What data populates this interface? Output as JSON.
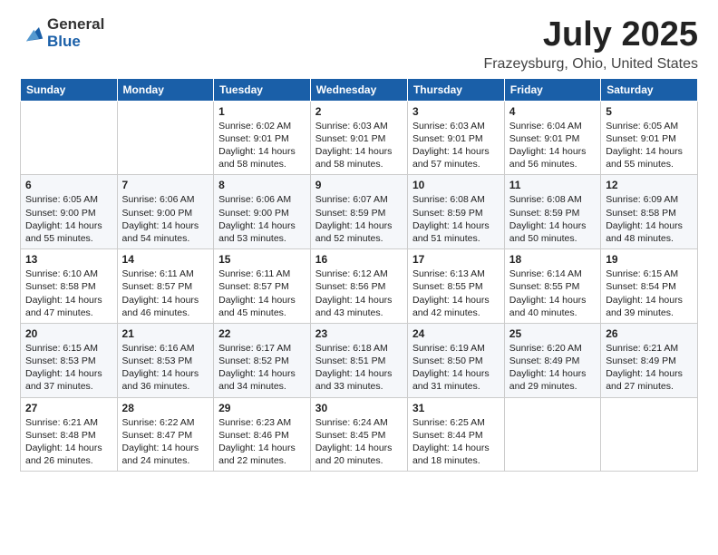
{
  "logo": {
    "general": "General",
    "blue": "Blue"
  },
  "title": "July 2025",
  "subtitle": "Frazeysburg, Ohio, United States",
  "days_of_week": [
    "Sunday",
    "Monday",
    "Tuesday",
    "Wednesday",
    "Thursday",
    "Friday",
    "Saturday"
  ],
  "weeks": [
    [
      {
        "day": "",
        "content": ""
      },
      {
        "day": "",
        "content": ""
      },
      {
        "day": "1",
        "content": "Sunrise: 6:02 AM\nSunset: 9:01 PM\nDaylight: 14 hours and 58 minutes."
      },
      {
        "day": "2",
        "content": "Sunrise: 6:03 AM\nSunset: 9:01 PM\nDaylight: 14 hours and 58 minutes."
      },
      {
        "day": "3",
        "content": "Sunrise: 6:03 AM\nSunset: 9:01 PM\nDaylight: 14 hours and 57 minutes."
      },
      {
        "day": "4",
        "content": "Sunrise: 6:04 AM\nSunset: 9:01 PM\nDaylight: 14 hours and 56 minutes."
      },
      {
        "day": "5",
        "content": "Sunrise: 6:05 AM\nSunset: 9:01 PM\nDaylight: 14 hours and 55 minutes."
      }
    ],
    [
      {
        "day": "6",
        "content": "Sunrise: 6:05 AM\nSunset: 9:00 PM\nDaylight: 14 hours and 55 minutes."
      },
      {
        "day": "7",
        "content": "Sunrise: 6:06 AM\nSunset: 9:00 PM\nDaylight: 14 hours and 54 minutes."
      },
      {
        "day": "8",
        "content": "Sunrise: 6:06 AM\nSunset: 9:00 PM\nDaylight: 14 hours and 53 minutes."
      },
      {
        "day": "9",
        "content": "Sunrise: 6:07 AM\nSunset: 8:59 PM\nDaylight: 14 hours and 52 minutes."
      },
      {
        "day": "10",
        "content": "Sunrise: 6:08 AM\nSunset: 8:59 PM\nDaylight: 14 hours and 51 minutes."
      },
      {
        "day": "11",
        "content": "Sunrise: 6:08 AM\nSunset: 8:59 PM\nDaylight: 14 hours and 50 minutes."
      },
      {
        "day": "12",
        "content": "Sunrise: 6:09 AM\nSunset: 8:58 PM\nDaylight: 14 hours and 48 minutes."
      }
    ],
    [
      {
        "day": "13",
        "content": "Sunrise: 6:10 AM\nSunset: 8:58 PM\nDaylight: 14 hours and 47 minutes."
      },
      {
        "day": "14",
        "content": "Sunrise: 6:11 AM\nSunset: 8:57 PM\nDaylight: 14 hours and 46 minutes."
      },
      {
        "day": "15",
        "content": "Sunrise: 6:11 AM\nSunset: 8:57 PM\nDaylight: 14 hours and 45 minutes."
      },
      {
        "day": "16",
        "content": "Sunrise: 6:12 AM\nSunset: 8:56 PM\nDaylight: 14 hours and 43 minutes."
      },
      {
        "day": "17",
        "content": "Sunrise: 6:13 AM\nSunset: 8:55 PM\nDaylight: 14 hours and 42 minutes."
      },
      {
        "day": "18",
        "content": "Sunrise: 6:14 AM\nSunset: 8:55 PM\nDaylight: 14 hours and 40 minutes."
      },
      {
        "day": "19",
        "content": "Sunrise: 6:15 AM\nSunset: 8:54 PM\nDaylight: 14 hours and 39 minutes."
      }
    ],
    [
      {
        "day": "20",
        "content": "Sunrise: 6:15 AM\nSunset: 8:53 PM\nDaylight: 14 hours and 37 minutes."
      },
      {
        "day": "21",
        "content": "Sunrise: 6:16 AM\nSunset: 8:53 PM\nDaylight: 14 hours and 36 minutes."
      },
      {
        "day": "22",
        "content": "Sunrise: 6:17 AM\nSunset: 8:52 PM\nDaylight: 14 hours and 34 minutes."
      },
      {
        "day": "23",
        "content": "Sunrise: 6:18 AM\nSunset: 8:51 PM\nDaylight: 14 hours and 33 minutes."
      },
      {
        "day": "24",
        "content": "Sunrise: 6:19 AM\nSunset: 8:50 PM\nDaylight: 14 hours and 31 minutes."
      },
      {
        "day": "25",
        "content": "Sunrise: 6:20 AM\nSunset: 8:49 PM\nDaylight: 14 hours and 29 minutes."
      },
      {
        "day": "26",
        "content": "Sunrise: 6:21 AM\nSunset: 8:49 PM\nDaylight: 14 hours and 27 minutes."
      }
    ],
    [
      {
        "day": "27",
        "content": "Sunrise: 6:21 AM\nSunset: 8:48 PM\nDaylight: 14 hours and 26 minutes."
      },
      {
        "day": "28",
        "content": "Sunrise: 6:22 AM\nSunset: 8:47 PM\nDaylight: 14 hours and 24 minutes."
      },
      {
        "day": "29",
        "content": "Sunrise: 6:23 AM\nSunset: 8:46 PM\nDaylight: 14 hours and 22 minutes."
      },
      {
        "day": "30",
        "content": "Sunrise: 6:24 AM\nSunset: 8:45 PM\nDaylight: 14 hours and 20 minutes."
      },
      {
        "day": "31",
        "content": "Sunrise: 6:25 AM\nSunset: 8:44 PM\nDaylight: 14 hours and 18 minutes."
      },
      {
        "day": "",
        "content": ""
      },
      {
        "day": "",
        "content": ""
      }
    ]
  ]
}
